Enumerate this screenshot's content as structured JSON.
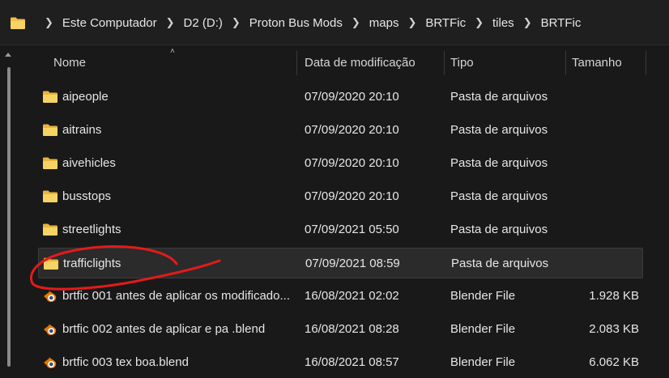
{
  "breadcrumb": [
    "Este Computador",
    "D2 (D:)",
    "Proton Bus Mods",
    "maps",
    "BRTFic",
    "tiles",
    "BRTFic"
  ],
  "columns": {
    "name": "Nome",
    "date": "Data de modificação",
    "type": "Tipo",
    "size": "Tamanho"
  },
  "files": [
    {
      "name": "aipeople",
      "date": "07/09/2020 20:10",
      "type": "Pasta de arquivos",
      "size": "",
      "icon": "folder-icon"
    },
    {
      "name": "aitrains",
      "date": "07/09/2020 20:10",
      "type": "Pasta de arquivos",
      "size": "",
      "icon": "folder-icon"
    },
    {
      "name": "aivehicles",
      "date": "07/09/2020 20:10",
      "type": "Pasta de arquivos",
      "size": "",
      "icon": "folder-icon"
    },
    {
      "name": "busstops",
      "date": "07/09/2020 20:10",
      "type": "Pasta de arquivos",
      "size": "",
      "icon": "folder-icon"
    },
    {
      "name": "streetlights",
      "date": "07/09/2021 05:50",
      "type": "Pasta de arquivos",
      "size": "",
      "icon": "folder-icon"
    },
    {
      "name": "trafficlights",
      "date": "07/09/2021 08:59",
      "type": "Pasta de arquivos",
      "size": "",
      "icon": "folder-icon"
    },
    {
      "name": "brtfic 001 antes de aplicar os modificado...",
      "date": "16/08/2021 02:02",
      "type": "Blender File",
      "size": "1.928 KB",
      "icon": "blender-icon"
    },
    {
      "name": "brtfic 002 antes de aplicar e pa .blend",
      "date": "16/08/2021 08:28",
      "type": "Blender File",
      "size": "2.083 KB",
      "icon": "blender-icon"
    },
    {
      "name": "brtfic 003 tex boa.blend",
      "date": "16/08/2021 08:57",
      "type": "Blender File",
      "size": "6.062 KB",
      "icon": "blender-icon"
    }
  ],
  "colors": {
    "folder": "#f0c04a",
    "blender_orange": "#ea7600",
    "blender_blue": "#265787",
    "annotation": "#e21b1b"
  }
}
